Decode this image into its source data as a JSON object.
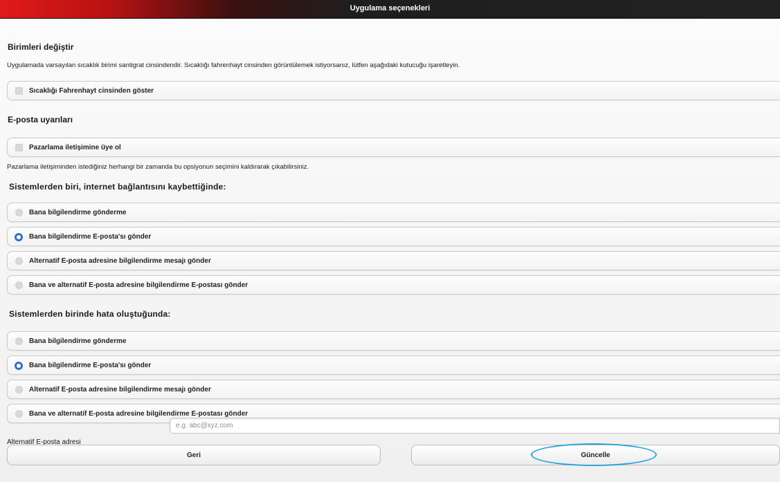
{
  "window": {
    "title": "Uygulama seçenekleri"
  },
  "units": {
    "heading": "Birimleri değiştir",
    "description": "Uygulamada varsayılan sıcaklık birimi santigrat cinsindendir. Sıcaklığı fahrenhayt cinsinden görüntülemek istiyorsanız, lütfen aşağıdaki kutucuğu işaretleyin.",
    "fahrenheit_label": "Sıcaklığı Fahrenhayt cinsinden göster"
  },
  "email_alerts": {
    "heading": "E-posta uyarıları",
    "marketing_label": "Pazarlama iletişimine üye ol",
    "marketing_note": "Pazarlama iletişiminden istediğiniz herhangi bir zamanda bu opsiyonun seçimini kaldırarak çıkabilirsiniz."
  },
  "connection_lost": {
    "heading": "Sistemlerden biri, internet bağlantısını kaybettiğinde:",
    "options": [
      "Bana bilgilendirme gönderme",
      "Bana bilgilendirme E-posta'sı gönder",
      "Alternatif E-posta adresine bilgilendirme mesajı gönder",
      "Bana ve alternatif E-posta adresine bilgilendirme E-postası gönder"
    ],
    "selected_index": 1
  },
  "error_occurred": {
    "heading": "Sistemlerden birinde hata oluştuğunda:",
    "options": [
      "Bana bilgilendirme gönderme",
      "Bana bilgilendirme E-posta'sı gönder",
      "Alternatif E-posta adresine bilgilendirme mesajı gönder",
      "Bana ve alternatif E-posta adresine bilgilendirme E-postası gönder"
    ],
    "selected_index": 1
  },
  "alt_email": {
    "label": "Alternatif E-posta adresi",
    "placeholder": "e.g. abc@xyz.com",
    "value": ""
  },
  "buttons": {
    "back": "Geri",
    "update": "Güncelle"
  },
  "colors": {
    "accent": "#2f70cc",
    "highlight": "#25a3dc"
  }
}
